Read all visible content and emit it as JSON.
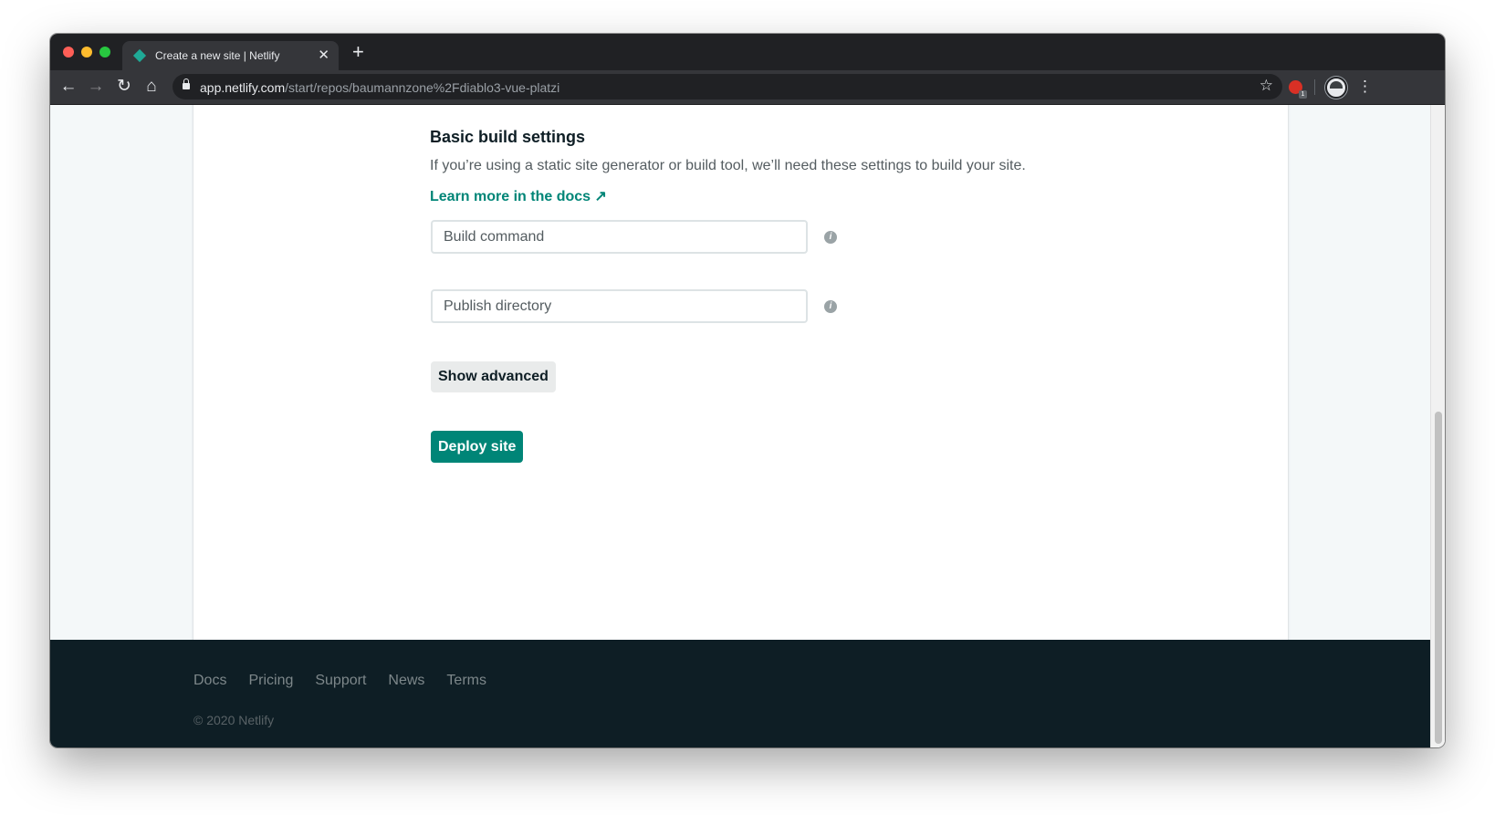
{
  "browser": {
    "tab_title": "Create a new site | Netlify",
    "tab_close_glyph": "✕",
    "new_tab_glyph": "+",
    "url_host": "app.netlify.com",
    "url_path": "/start/repos/baumannzone%2Fdiablo3-vue-platzi",
    "extension_badge": "1",
    "icons": [
      "back-arrow-icon",
      "forward-arrow-icon",
      "reload-icon",
      "home-icon",
      "lock-icon",
      "star-icon",
      "extension-icon",
      "avatar",
      "menu-icon"
    ]
  },
  "build_settings": {
    "title": "Basic build settings",
    "description": "If you’re using a static site generator or build tool, we’ll need these settings to build your site.",
    "docs_link": "Learn more in the docs ↗",
    "build_command_placeholder": "Build command",
    "build_command_value": "",
    "publish_directory_placeholder": "Publish directory",
    "publish_directory_value": "",
    "info_glyph": "i",
    "show_advanced_label": "Show advanced",
    "deploy_label": "Deploy site"
  },
  "footer": {
    "links": [
      "Docs",
      "Pricing",
      "Support",
      "News",
      "Terms"
    ],
    "copyright": "© 2020 Netlify"
  },
  "colors": {
    "accent": "#008577",
    "footer_bg": "#0e1e25",
    "page_bg": "#f4f8f9",
    "browser_chrome": "#35363a"
  }
}
